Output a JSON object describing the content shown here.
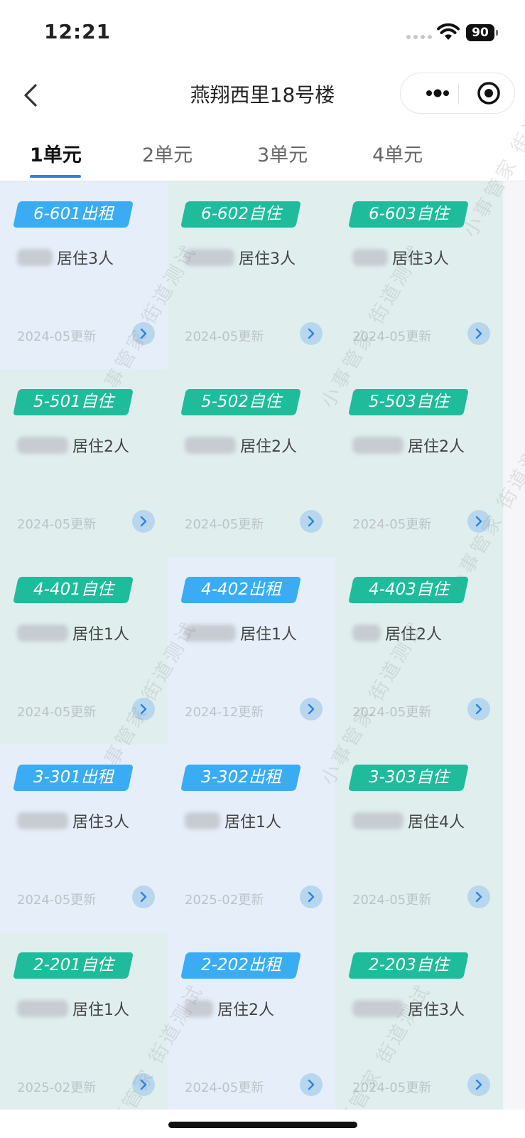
{
  "status_bar": {
    "time": "12:21",
    "battery": "90"
  },
  "nav": {
    "title": "燕翔西里18号楼"
  },
  "tabs": [
    {
      "label": "1单元",
      "active": true
    },
    {
      "label": "2单元",
      "active": false
    },
    {
      "label": "3单元",
      "active": false
    },
    {
      "label": "4单元",
      "active": false
    }
  ],
  "units": [
    {
      "room": "6-601出租",
      "residents": "居住3人",
      "updated": "2024-05更新",
      "status": "rent"
    },
    {
      "room": "6-602自住",
      "residents": "居住3人",
      "updated": "2024-05更新",
      "status": "own"
    },
    {
      "room": "6-603自住",
      "residents": "居住3人",
      "updated": "2024-05更新",
      "status": "own"
    },
    {
      "room": "5-501自住",
      "residents": "居住2人",
      "updated": "2024-05更新",
      "status": "own"
    },
    {
      "room": "5-502自住",
      "residents": "居住2人",
      "updated": "2024-05更新",
      "status": "own"
    },
    {
      "room": "5-503自住",
      "residents": "居住2人",
      "updated": "2024-05更新",
      "status": "own"
    },
    {
      "room": "4-401自住",
      "residents": "居住1人",
      "updated": "2024-05更新",
      "status": "own"
    },
    {
      "room": "4-402出租",
      "residents": "居住1人",
      "updated": "2024-12更新",
      "status": "rent"
    },
    {
      "room": "4-403自住",
      "residents": "居住2人",
      "updated": "2024-05更新",
      "status": "own"
    },
    {
      "room": "3-301出租",
      "residents": "居住3人",
      "updated": "2024-05更新",
      "status": "rent"
    },
    {
      "room": "3-302出租",
      "residents": "居住1人",
      "updated": "2025-02更新",
      "status": "rent"
    },
    {
      "room": "3-303自住",
      "residents": "居住4人",
      "updated": "2024-05更新",
      "status": "own"
    },
    {
      "room": "2-201自住",
      "residents": "居住1人",
      "updated": "2025-02更新",
      "status": "own"
    },
    {
      "room": "2-202出租",
      "residents": "居住2人",
      "updated": "2024-05更新",
      "status": "rent"
    },
    {
      "room": "2-203自住",
      "residents": "居住3人",
      "updated": "2024-05更新",
      "status": "own"
    }
  ],
  "watermark": "小事管家 街道测试",
  "colors": {
    "rent_tag": "#3aacf4",
    "own_tag": "#1fbc9c",
    "accent": "#2b84e0"
  },
  "icons": [
    "back-chevron-icon",
    "more-dots-icon",
    "target-circle-icon",
    "chevron-right-icon",
    "wifi-icon",
    "battery-icon"
  ]
}
